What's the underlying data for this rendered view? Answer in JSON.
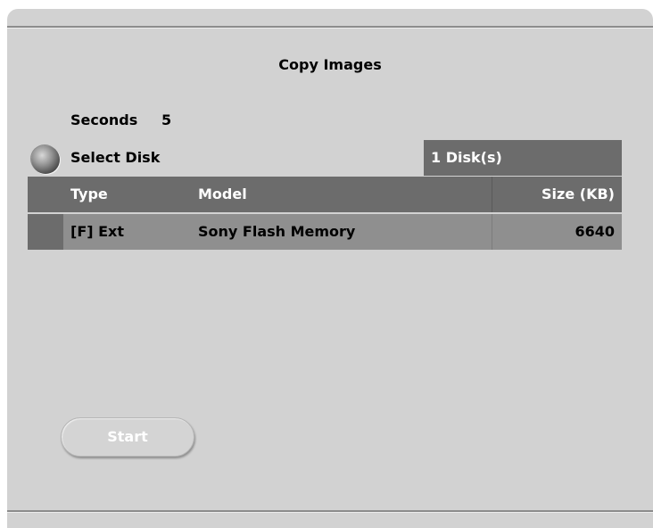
{
  "dialog": {
    "title": "Copy Images"
  },
  "seconds": {
    "label": "Seconds",
    "value": "5"
  },
  "select_disk": {
    "label": "Select Disk",
    "disk_count": "1 Disk(s)"
  },
  "disk_table": {
    "columns": {
      "type": "Type",
      "model": "Model",
      "size": "Size (KB)"
    },
    "rows": [
      {
        "type": "[F] Ext",
        "model": "Sony Flash Memory",
        "size": "6640"
      }
    ]
  },
  "start_button": {
    "label": "Start"
  },
  "colors": {
    "panel_bg": "#d2d2d2",
    "header_bg": "#6c6c6c",
    "row_bg": "#8f8f8f"
  },
  "icons": {
    "radio": "radio-button-icon"
  }
}
